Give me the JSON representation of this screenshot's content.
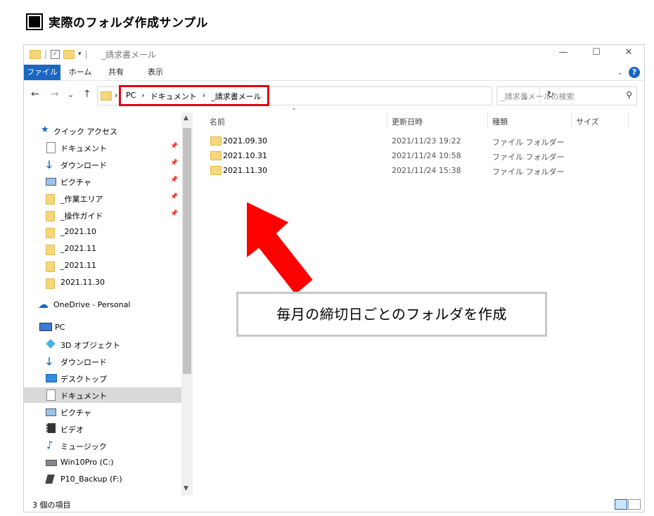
{
  "heading": "実際のフォルダ作成サンプル",
  "window": {
    "title": "_請求書メール",
    "controls": {
      "minimize": "—",
      "maximize": "☐",
      "close": "✕"
    }
  },
  "ribbon": {
    "tabs": [
      "ファイル",
      "ホーム",
      "共有",
      "表示"
    ],
    "help": "?"
  },
  "nav_buttons": {
    "back": "←",
    "forward": "→",
    "dropdown": "⌄",
    "up": "↑"
  },
  "address": {
    "crumbs": [
      "PC",
      "›",
      "ドキュメント",
      "›",
      "_請求書メール"
    ],
    "leading": "›"
  },
  "search": {
    "placeholder": "_請求書メールの検索"
  },
  "nav_pane": {
    "quick_access": "クイック アクセス",
    "items": [
      {
        "label": "ドキュメント",
        "icon": "document-icon",
        "pinned": true
      },
      {
        "label": "ダウンロード",
        "icon": "download-icon",
        "pinned": true
      },
      {
        "label": "ピクチャ",
        "icon": "picture-icon",
        "pinned": true
      },
      {
        "label": "_作業エリア",
        "icon": "folder-icon",
        "pinned": true
      },
      {
        "label": "_操作ガイド",
        "icon": "folder-icon",
        "pinned": true
      },
      {
        "label": "_2021.10",
        "icon": "folder-icon",
        "pinned": false
      },
      {
        "label": "_2021.11",
        "icon": "folder-icon",
        "pinned": false
      },
      {
        "label": "_2021.11",
        "icon": "folder-icon",
        "pinned": false
      },
      {
        "label": "2021.11.30",
        "icon": "folder-icon",
        "pinned": false
      }
    ],
    "onedrive": "OneDrive - Personal",
    "pc": "PC",
    "pc_items": [
      {
        "label": "3D オブジェクト",
        "icon": "cube-icon"
      },
      {
        "label": "ダウンロード",
        "icon": "download-icon"
      },
      {
        "label": "デスクトップ",
        "icon": "desktop-icon"
      },
      {
        "label": "ドキュメント",
        "icon": "document-icon",
        "selected": true
      },
      {
        "label": "ピクチャ",
        "icon": "picture-icon"
      },
      {
        "label": "ビデオ",
        "icon": "video-icon"
      },
      {
        "label": "ミュージック",
        "icon": "music-icon"
      },
      {
        "label": "Win10Pro (C:)",
        "icon": "drive-icon"
      },
      {
        "label": "P10_Backup (F:)",
        "icon": "usb-drive-icon"
      }
    ]
  },
  "columns": [
    "名前",
    "更新日時",
    "種類",
    "サイズ"
  ],
  "files": [
    {
      "name": "2021.09.30",
      "modified": "2021/11/23 19:22",
      "type": "ファイル フォルダー"
    },
    {
      "name": "2021.10.31",
      "modified": "2021/11/24 10:58",
      "type": "ファイル フォルダー"
    },
    {
      "name": "2021.11.30",
      "modified": "2021/11/24 15:38",
      "type": "ファイル フォルダー"
    }
  ],
  "callout": "毎月の締切日ごとのフォルダを作成",
  "status": "3 個の項目",
  "colors": {
    "accent": "#1a66c2",
    "highlight": "#e3000f",
    "folder": "#f6d77b"
  }
}
